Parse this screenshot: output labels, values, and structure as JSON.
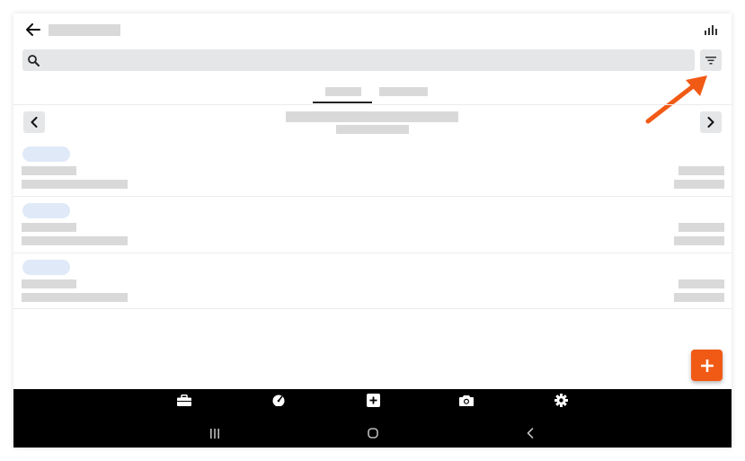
{
  "header": {
    "back_icon": "arrow-left-icon",
    "chart_icon": "bar-chart-icon"
  },
  "search": {
    "icon": "search-icon",
    "placeholder": ""
  },
  "filter": {
    "icon": "filter-icon"
  },
  "navigation": {
    "prev_icon": "chevron-left-icon",
    "next_icon": "chevron-right-icon"
  },
  "fab": {
    "icon": "plus-icon",
    "color": "#f15a15"
  },
  "annotation": {
    "color": "#f15a15"
  },
  "bottom_nav": {
    "items": [
      "briefcase-icon",
      "gauge-icon",
      "add-square-icon",
      "camera-icon",
      "gear-icon"
    ]
  },
  "system_nav": {
    "items": [
      "recents-icon",
      "home-icon",
      "back-icon"
    ]
  }
}
